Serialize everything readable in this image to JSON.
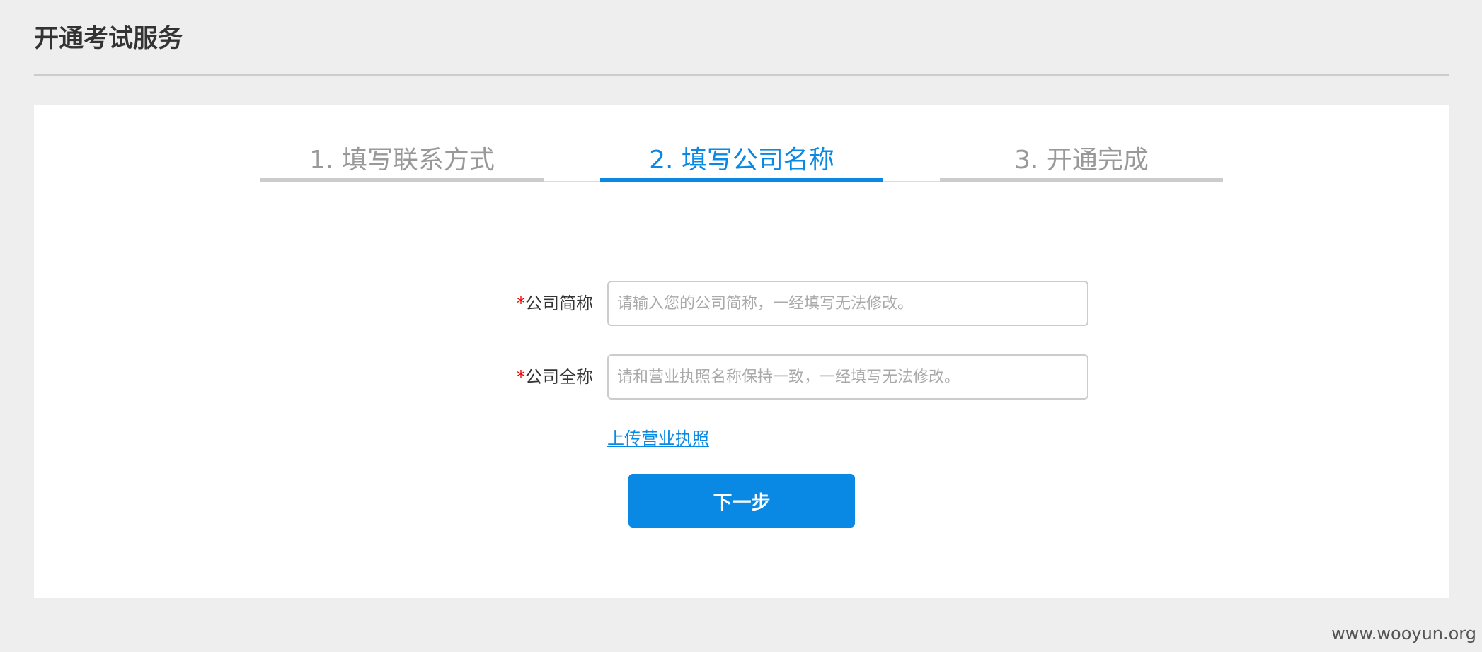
{
  "header": {
    "title": "开通考试服务"
  },
  "steps": [
    {
      "label": "1. 填写联系方式",
      "state": "done"
    },
    {
      "label": "2. 填写公司名称",
      "state": "active"
    },
    {
      "label": "3. 开通完成",
      "state": "pending"
    }
  ],
  "form": {
    "required_mark": "*",
    "short_name": {
      "label": "公司简称",
      "value": "",
      "placeholder": "请输入您的公司简称，一经填写无法修改。"
    },
    "full_name": {
      "label": "公司全称",
      "value": "",
      "placeholder": "请和营业执照名称保持一致，一经填写无法修改。"
    },
    "upload_link": "上传营业执照",
    "next_button": "下一步"
  },
  "watermark": "www.wooyun.org",
  "colors": {
    "accent": "#0a89e4",
    "required": "#ee0000",
    "background": "#eeeeee"
  }
}
